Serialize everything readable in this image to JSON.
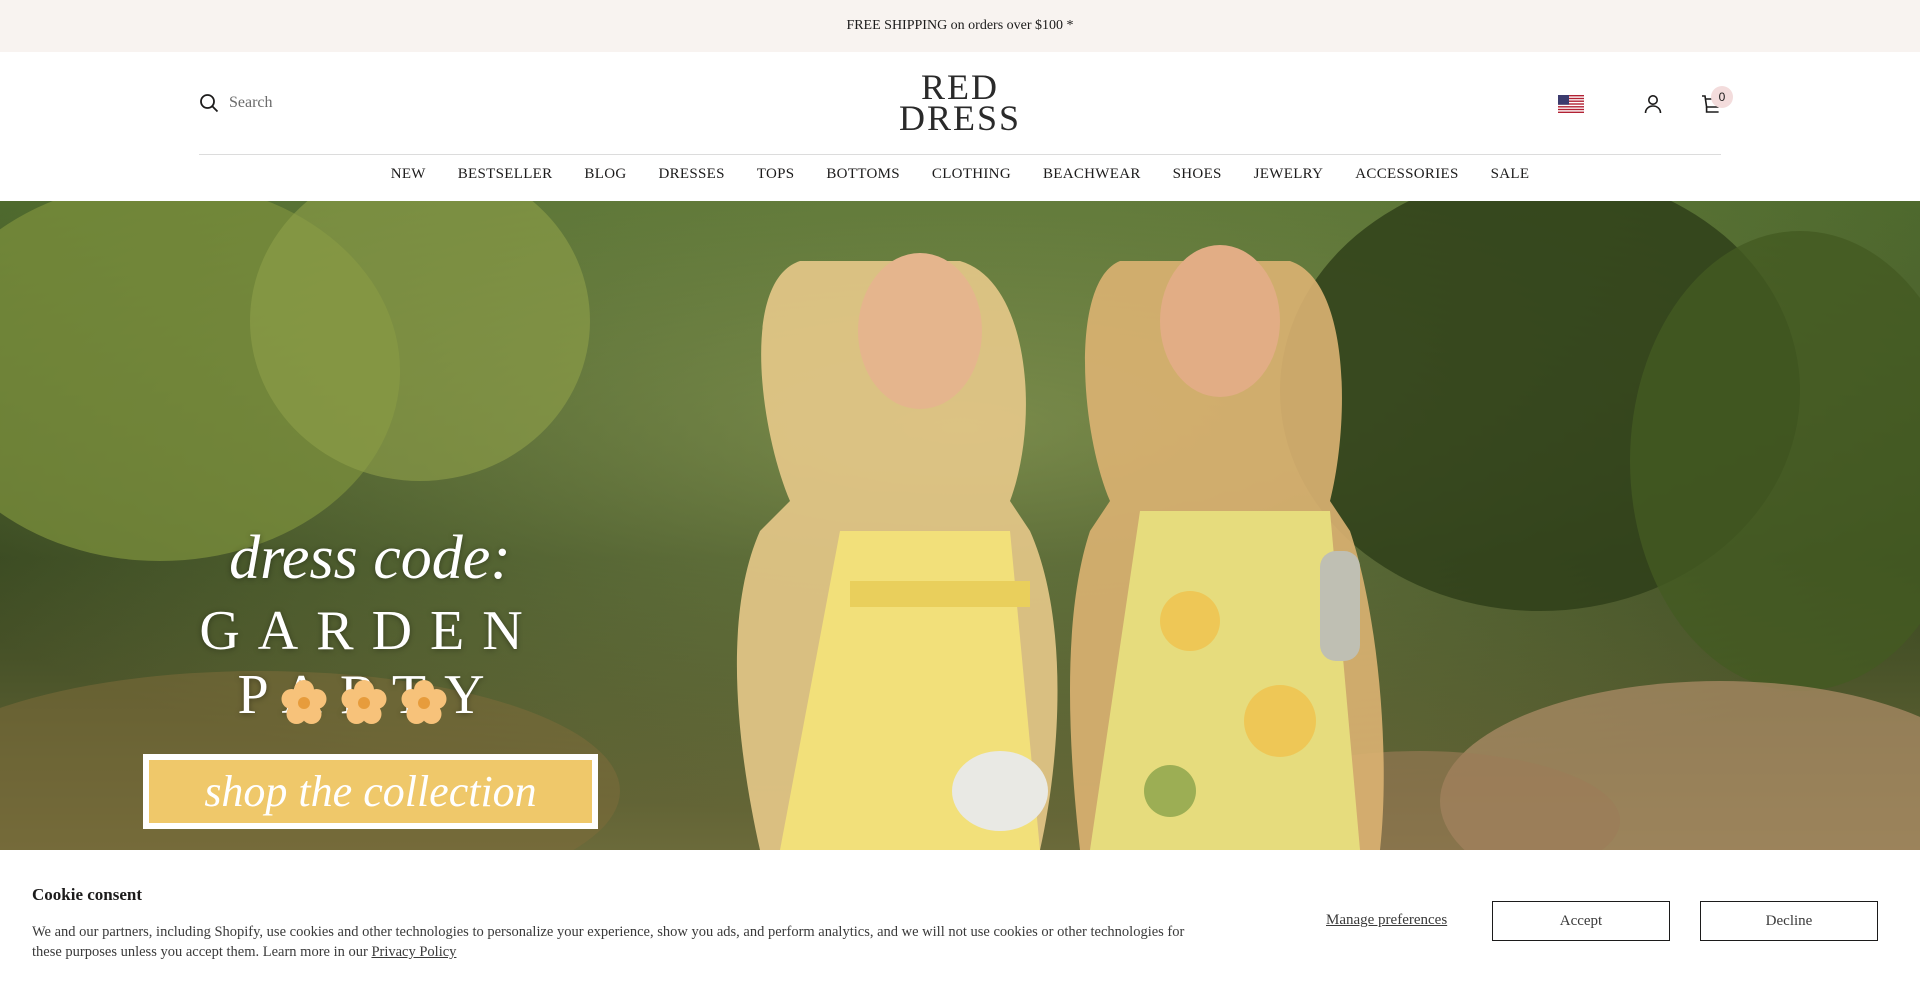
{
  "announcement": {
    "text": "FREE SHIPPING on orders over $100 *"
  },
  "header": {
    "search_label": "Search",
    "logo_line1": "RED",
    "logo_line2": "DRESS",
    "cart_count": "0",
    "icons": [
      "search-icon",
      "us-flag-icon",
      "account-icon",
      "cart-icon"
    ]
  },
  "nav": {
    "items": [
      "NEW",
      "BESTSELLER",
      "BLOG",
      "DRESSES",
      "TOPS",
      "BOTTOMS",
      "CLOTHING",
      "BEACHWEAR",
      "SHOES",
      "JEWELRY",
      "ACCESSORIES",
      "SALE"
    ]
  },
  "hero": {
    "script_text": "dress code:",
    "title": "GARDEN PARTY",
    "cta_label": "shop the collection"
  },
  "cookie": {
    "title": "Cookie consent",
    "body": "We and our partners, including Shopify, use cookies and other technologies to personalize your experience, show you ads, and perform analytics, and we will not use cookies or other technologies for these purposes unless you accept them. Learn more in our",
    "privacy_link": "Privacy Policy",
    "manage_label": "Manage preferences",
    "accept_label": "Accept",
    "decline_label": "Decline"
  },
  "colors": {
    "announcement_bg": "#f8f3f0",
    "cta_bg": "#efc86a",
    "cart_badge_bg": "#f3dcdc"
  }
}
